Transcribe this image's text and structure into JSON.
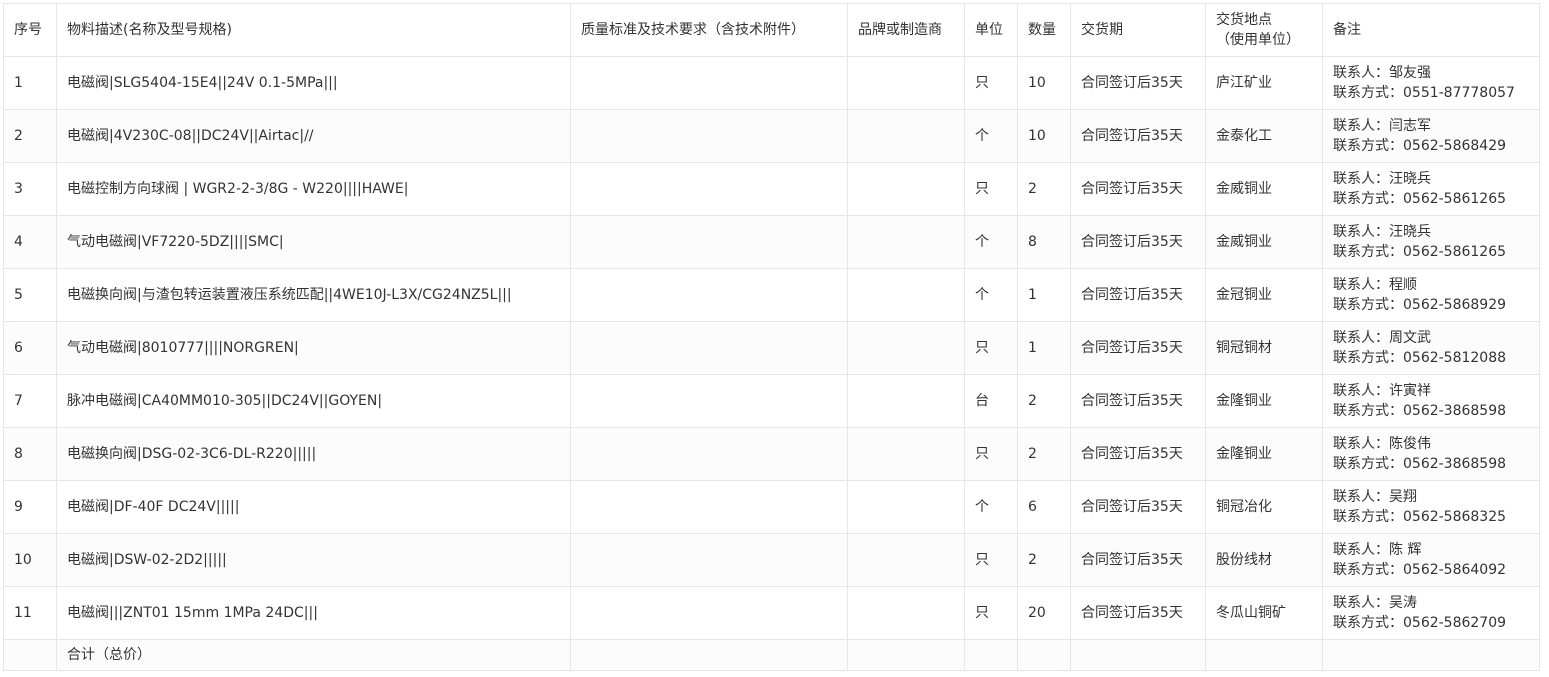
{
  "table": {
    "headers": [
      {
        "key": "index",
        "label": "序号"
      },
      {
        "key": "description",
        "label": "物料描述(名称及型号规格)"
      },
      {
        "key": "quality",
        "label": "质量标准及技术要求（含技术附件）"
      },
      {
        "key": "brand",
        "label": "品牌或制造商"
      },
      {
        "key": "unit",
        "label": "单位"
      },
      {
        "key": "quantity",
        "label": "数量"
      },
      {
        "key": "delivery",
        "label": "交货期"
      },
      {
        "key": "location",
        "label": "交货地点",
        "sub": "（使用单位）"
      },
      {
        "key": "remark",
        "label": "备注"
      }
    ],
    "rows": [
      {
        "index": "1",
        "description": "电磁阀|SLG5404-15E4||24V 0.1-5MPa|||",
        "quality": "",
        "brand": "",
        "unit": "只",
        "quantity": "10",
        "delivery": "合同签订后35天",
        "location": "庐江矿业",
        "contact": "联系人：邹友强",
        "phone": "联系方式：0551-87778057"
      },
      {
        "index": "2",
        "description": "电磁阀|4V230C-08||DC24V||Airtac|//",
        "quality": "",
        "brand": "",
        "unit": "个",
        "quantity": "10",
        "delivery": "合同签订后35天",
        "location": "金泰化工",
        "contact": "联系人：闫志军",
        "phone": "联系方式：0562-5868429"
      },
      {
        "index": "3",
        "description": "电磁控制方向球阀 | WGR2-2-3/8G - W220||||HAWE|",
        "quality": "",
        "brand": "",
        "unit": "只",
        "quantity": "2",
        "delivery": "合同签订后35天",
        "location": "金威铜业",
        "contact": "联系人：汪晓兵",
        "phone": "联系方式：0562-5861265"
      },
      {
        "index": "4",
        "description": "气动电磁阀|VF7220-5DZ||||SMC|",
        "quality": "",
        "brand": "",
        "unit": "个",
        "quantity": "8",
        "delivery": "合同签订后35天",
        "location": "金威铜业",
        "contact": "联系人：汪晓兵",
        "phone": "联系方式：0562-5861265"
      },
      {
        "index": "5",
        "description": "电磁换向阀|与渣包转运装置液压系统匹配||4WE10J-L3X/CG24NZ5L|||",
        "quality": "",
        "brand": "",
        "unit": "个",
        "quantity": "1",
        "delivery": "合同签订后35天",
        "location": "金冠铜业",
        "contact": "联系人：程顺",
        "phone": "联系方式：0562-5868929"
      },
      {
        "index": "6",
        "description": "气动电磁阀|8010777||||NORGREN|",
        "quality": "",
        "brand": "",
        "unit": "只",
        "quantity": "1",
        "delivery": "合同签订后35天",
        "location": "铜冠铜材",
        "contact": "联系人：周文武",
        "phone": "联系方式：0562-5812088"
      },
      {
        "index": "7",
        "description": "脉冲电磁阀|CA40MM010-305||DC24V||GOYEN|",
        "quality": "",
        "brand": "",
        "unit": "台",
        "quantity": "2",
        "delivery": "合同签订后35天",
        "location": "金隆铜业",
        "contact": "联系人：许寅祥",
        "phone": "联系方式：0562-3868598"
      },
      {
        "index": "8",
        "description": "电磁换向阀|DSG-02-3C6-DL-R220|||||",
        "quality": "",
        "brand": "",
        "unit": "只",
        "quantity": "2",
        "delivery": "合同签订后35天",
        "location": "金隆铜业",
        "contact": "联系人：陈俊伟",
        "phone": "联系方式：0562-3868598"
      },
      {
        "index": "9",
        "description": "电磁阀|DF-40F DC24V|||||",
        "quality": "",
        "brand": "",
        "unit": "个",
        "quantity": "6",
        "delivery": "合同签订后35天",
        "location": "铜冠冶化",
        "contact": "联系人：吴翔",
        "phone": "联系方式：0562-5868325"
      },
      {
        "index": "10",
        "description": "电磁阀|DSW-02-2D2|||||",
        "quality": "",
        "brand": "",
        "unit": "只",
        "quantity": "2",
        "delivery": "合同签订后35天",
        "location": "股份线材",
        "contact": "联系人：陈 辉",
        "phone": "联系方式：0562-5864092"
      },
      {
        "index": "11",
        "description": "电磁阀|||ZNT01 15mm 1MPa 24DC|||",
        "quality": "",
        "brand": "",
        "unit": "只",
        "quantity": "20",
        "delivery": "合同签订后35天",
        "location": "冬瓜山铜矿",
        "contact": "联系人：吴涛",
        "phone": "联系方式：0562-5862709"
      }
    ],
    "total_label": "合计（总价）"
  }
}
